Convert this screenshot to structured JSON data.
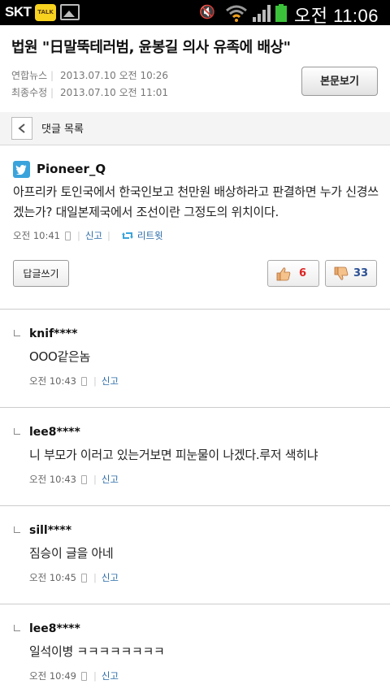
{
  "status_bar": {
    "carrier": "SKT",
    "talk_badge": "TALK",
    "time": "오전 11:06",
    "icons": [
      "kakaotalk-icon",
      "gallery-icon",
      "mute-icon",
      "wifi-icon",
      "signal-icon",
      "battery-icon"
    ],
    "battery_color": "#3cc13b"
  },
  "article": {
    "title": "법원 \"日말뚝테러범, 윤봉길 의사 유족에 배상\"",
    "source_label": "연합뉴스",
    "source_date": "2013.07.10 오전 10:26",
    "modified_label": "최종수정",
    "modified_date": "2013.07.10 오전 11:01",
    "view_button": "본문보기"
  },
  "list_header": {
    "title": "댓글 목록"
  },
  "main_comment": {
    "author": "Pioneer_Q",
    "body": "아프리카 토인국에서 한국인보고 천만원 배상하라고 판결하면 누가 신경쓰겠는가? 대일본제국에서 조선이란 그정도의 위치이다.",
    "time": "오전 10:41",
    "report": "신고",
    "retweet": "리트윗",
    "reply_button": "답글쓰기",
    "likes": "6",
    "dislikes": "33"
  },
  "replies": [
    {
      "author": "knif****",
      "body": "OOO같은놈",
      "time": "오전 10:43",
      "report": "신고"
    },
    {
      "author": "lee8****",
      "body": "니 부모가 이러고 있는거보면 피눈물이 나겠다.루저 색히냐",
      "time": "오전 10:43",
      "report": "신고"
    },
    {
      "author": "sill****",
      "body": "짐승이 글을 아네",
      "time": "오전 10:45",
      "report": "신고"
    },
    {
      "author": "lee8****",
      "body": "일석이병 ㅋㅋㅋㅋㅋㅋㅋㅋ",
      "time": "오전 10:49",
      "report": "신고"
    }
  ],
  "colors": {
    "twitter": "#3aa3db",
    "like": "#dd2222",
    "dislike": "#2a4f94",
    "link": "#2a6aa8"
  }
}
